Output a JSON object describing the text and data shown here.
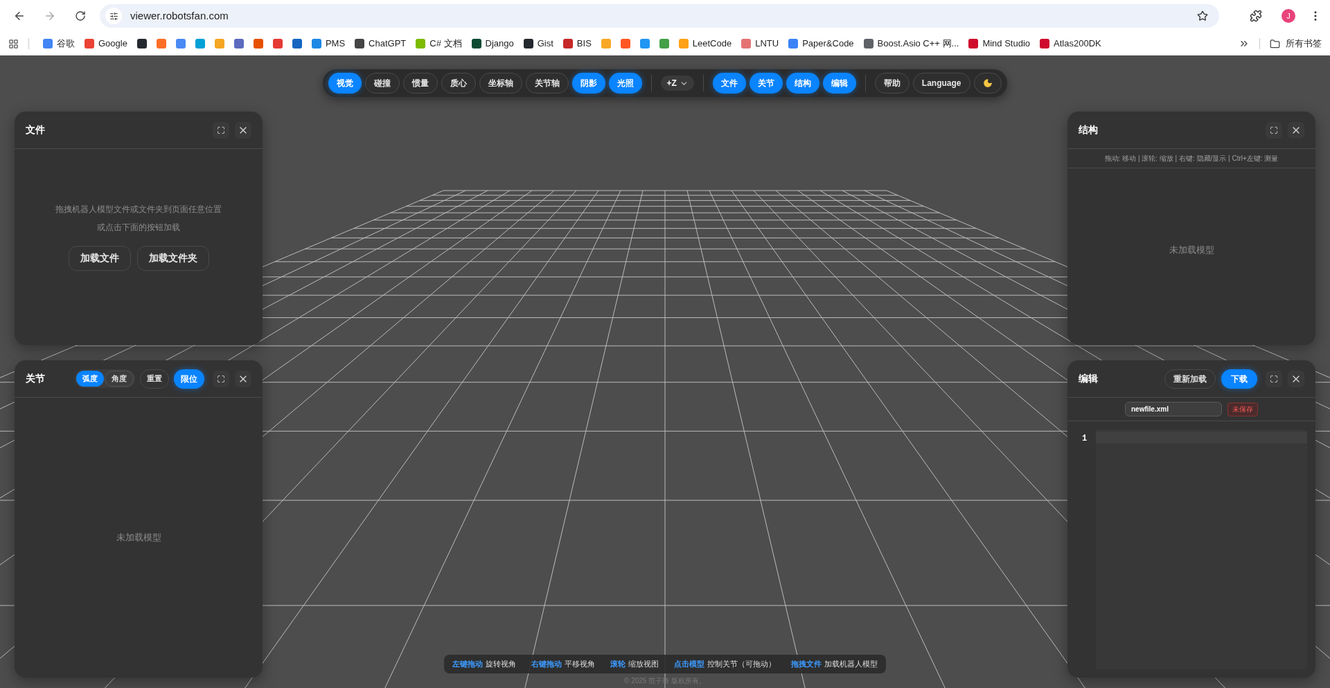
{
  "browser": {
    "url": "viewer.robotsfan.com",
    "avatar": "J",
    "bookmarks": [
      {
        "label": "谷歌",
        "color": "#4285f4"
      },
      {
        "label": "Google",
        "color": "#ea4335"
      },
      {
        "color": "#24292f"
      },
      {
        "color": "#fc6d26"
      },
      {
        "color": "#4a8af4"
      },
      {
        "color": "#00a1d6"
      },
      {
        "color": "#f5a623"
      },
      {
        "color": "#5c6bc0"
      },
      {
        "color": "#e65100"
      },
      {
        "color": "#e53935"
      },
      {
        "color": "#1565c0"
      },
      {
        "label": "PMS",
        "color": "#1e88e5"
      },
      {
        "label": "ChatGPT",
        "color": "#444444"
      },
      {
        "label": "C# 文档",
        "color": "#7cbb00"
      },
      {
        "label": "Django",
        "color": "#0c4b33"
      },
      {
        "label": "Gist",
        "color": "#24292f"
      },
      {
        "label": "BIS",
        "color": "#c62828"
      },
      {
        "color": "#f9a825"
      },
      {
        "color": "#ff5722"
      },
      {
        "color": "#2196f3"
      },
      {
        "color": "#43a047"
      },
      {
        "label": "LeetCode",
        "color": "#ffa116"
      },
      {
        "label": "LNTU",
        "color": "#e57373"
      },
      {
        "label": "Paper&Code",
        "color": "#3b82f6"
      },
      {
        "label": "Boost.Asio C++ 网...",
        "color": "#5f6368"
      },
      {
        "label": "Mind Studio",
        "color": "#cf0a2c"
      },
      {
        "label": "Atlas200DK",
        "color": "#cf0a2c"
      }
    ],
    "all_bookmarks": "所有书签"
  },
  "toolbar": {
    "view_toggles": [
      {
        "label": "视觉",
        "selected": true
      },
      {
        "label": "碰撞",
        "selected": false
      },
      {
        "label": "惯量",
        "selected": false
      },
      {
        "label": "质心",
        "selected": false
      },
      {
        "label": "坐标轴",
        "selected": false
      },
      {
        "label": "关节轴",
        "selected": false
      },
      {
        "label": "阴影",
        "selected": true
      },
      {
        "label": "光照",
        "selected": true
      }
    ],
    "up_axis": "+Z",
    "panel_toggles": [
      {
        "label": "文件",
        "selected": true
      },
      {
        "label": "关节",
        "selected": true
      },
      {
        "label": "结构",
        "selected": true
      },
      {
        "label": "编辑",
        "selected": true
      }
    ],
    "help": "帮助",
    "language": "Language"
  },
  "file_panel": {
    "title": "文件",
    "hint_lines": [
      "拖拽机器人模型文件或文件夹到页面任意位置",
      "或点击下面的按钮加载"
    ],
    "buttons": [
      "加载文件",
      "加载文件夹"
    ]
  },
  "joint_panel": {
    "title": "关节",
    "units": [
      {
        "label": "弧度",
        "selected": true
      },
      {
        "label": "角度",
        "selected": false
      }
    ],
    "reset": "重置",
    "limits": {
      "label": "限位",
      "on": true
    },
    "empty": "未加载模型"
  },
  "structure_panel": {
    "title": "结构",
    "hint": "拖动: 移动 | 滚轮: 缩放 | 右键: 隐藏/显示 | Ctrl+左键: 测量",
    "empty": "未加载模型"
  },
  "editor_panel": {
    "title": "编辑",
    "reload": "重新加载",
    "download": "下载",
    "filename": "newfile.xml",
    "status": "未保存",
    "line_numbers": [
      "1"
    ]
  },
  "hints": [
    {
      "key": "左键拖动",
      "action": "旋转视角"
    },
    {
      "key": "右键拖动",
      "action": "平移视角"
    },
    {
      "key": "滚轮",
      "action": "缩放视图"
    },
    {
      "key": "点击模型",
      "action": "控制关节（可拖动）"
    },
    {
      "key": "拖拽文件",
      "action": "加载机器人模型"
    }
  ],
  "copyright": "© 2025 范子琦 版权所有。"
}
